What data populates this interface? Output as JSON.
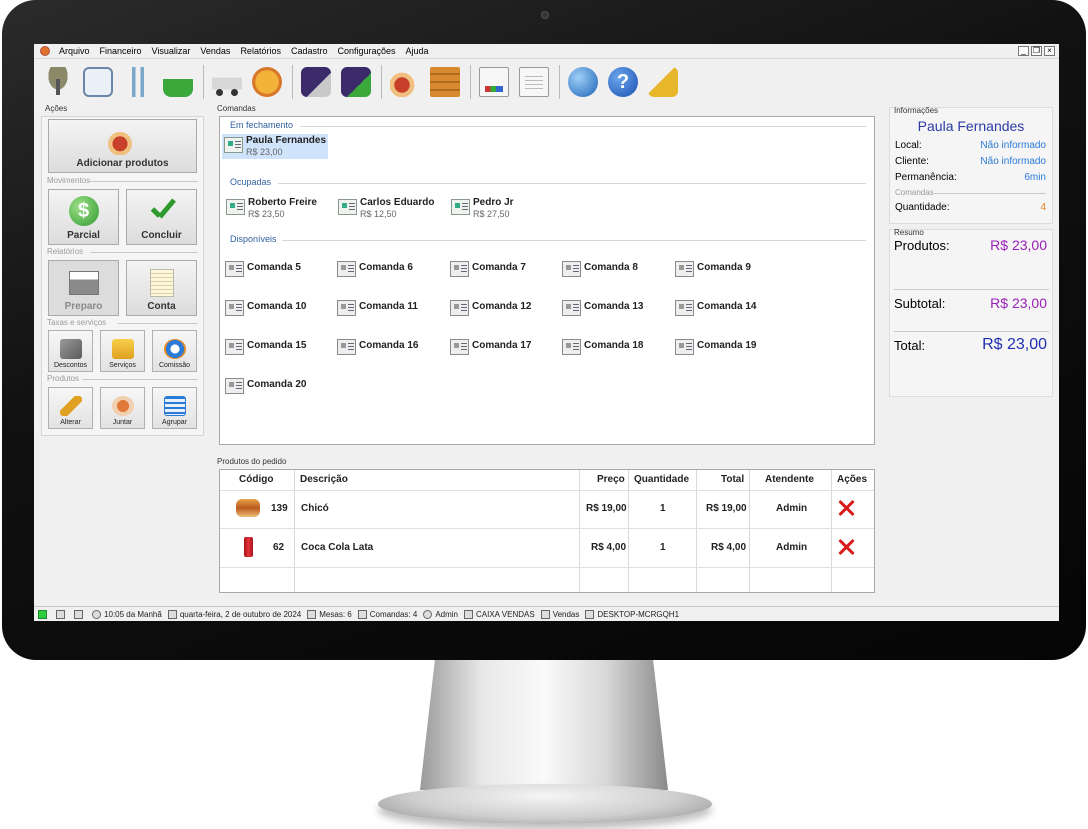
{
  "menu": [
    "Arquivo",
    "Financeiro",
    "Visualizar",
    "Vendas",
    "Relatórios",
    "Cadastro",
    "Configurações",
    "Ajuda"
  ],
  "window_controls": [
    "_",
    "❐",
    "×"
  ],
  "toolbar": [
    "table-icon",
    "card-icon",
    "utensils-icon",
    "basket-icon",
    "delivery-icon",
    "pizza-icon",
    "card-swipe-icon",
    "card-add-icon",
    "drink-add-icon",
    "crate-icon",
    "report-icon",
    "report2-icon",
    "globe-icon",
    "help-icon",
    "broom-icon"
  ],
  "left": {
    "title": "Ações",
    "add_products": "Adicionar produtos",
    "movimentos": "Movimentos",
    "parcial": "Parcial",
    "concluir": "Concluir",
    "relatorios": "Relatórios",
    "preparo": "Preparo",
    "conta": "Conta",
    "taxas": "Taxas e serviços",
    "descontos": "Descontos",
    "servicos": "Serviços",
    "comissao": "Comissão",
    "produtos": "Produtos",
    "alterar": "Alterar",
    "juntar": "Juntar",
    "agrupar": "Agrupar"
  },
  "comandas": {
    "title": "Comandas",
    "em_fechamento_label": "Em fechamento",
    "em_fechamento": [
      {
        "name": "Paula Fernandes",
        "value": "R$ 23,00"
      }
    ],
    "ocupadas_label": "Ocupadas",
    "ocupadas": [
      {
        "name": "Roberto Freire",
        "value": "R$ 23,50"
      },
      {
        "name": "Carlos Eduardo",
        "value": "R$ 12,50"
      },
      {
        "name": "Pedro Jr",
        "value": "R$ 27,50"
      }
    ],
    "disponiveis_label": "Disponíveis",
    "disponiveis": [
      "Comanda 5",
      "Comanda 6",
      "Comanda 7",
      "Comanda 8",
      "Comanda 9",
      "Comanda 10",
      "Comanda 11",
      "Comanda 12",
      "Comanda 13",
      "Comanda 14",
      "Comanda 15",
      "Comanda 16",
      "Comanda 17",
      "Comanda 18",
      "Comanda 19",
      "Comanda 20"
    ]
  },
  "info": {
    "title": "Informações",
    "name": "Paula Fernandes",
    "local_label": "Local:",
    "local": "Não informado",
    "cliente_label": "Cliente:",
    "cliente": "Não informado",
    "perm_label": "Permanência:",
    "perm": "6min",
    "comandas_label": "Comandas",
    "qtd_label": "Quantidade:",
    "qtd": "4"
  },
  "resumo": {
    "title": "Resumo",
    "produtos_label": "Produtos:",
    "produtos": "R$ 23,00",
    "subtotal_label": "Subtotal:",
    "subtotal": "R$ 23,00",
    "total_label": "Total:",
    "total": "R$ 23,00"
  },
  "pedido": {
    "title": "Produtos do pedido",
    "headers": [
      "Código",
      "Descrição",
      "Preço",
      "Quantidade",
      "Total",
      "Atendente",
      "Ações"
    ],
    "rows": [
      {
        "icon": "sandwich-icon",
        "codigo": "139",
        "descricao": "Chicó",
        "preco": "R$ 19,00",
        "quantidade": "1",
        "total": "R$ 19,00",
        "atendente": "Admin"
      },
      {
        "icon": "soda-can-icon",
        "codigo": "62",
        "descricao": "Coca Cola Lata",
        "preco": "R$ 4,00",
        "quantidade": "1",
        "total": "R$ 4,00",
        "atendente": "Admin"
      }
    ]
  },
  "status": {
    "time": "10:05 da Manhã",
    "date": "quarta-feira, 2 de outubro de 2024",
    "mesas": "Mesas: 6",
    "comandas": "Comandas: 4",
    "user": "Admin",
    "caixa": "CAIXA VENDAS",
    "vendas": "Vendas",
    "machine": "DESKTOP-MCRGQH1"
  },
  "colors": {
    "accent": "#2b3aa8",
    "value_purple": "#9a1fb8",
    "link_blue": "#2a7ad8",
    "orange": "#e0801a"
  }
}
